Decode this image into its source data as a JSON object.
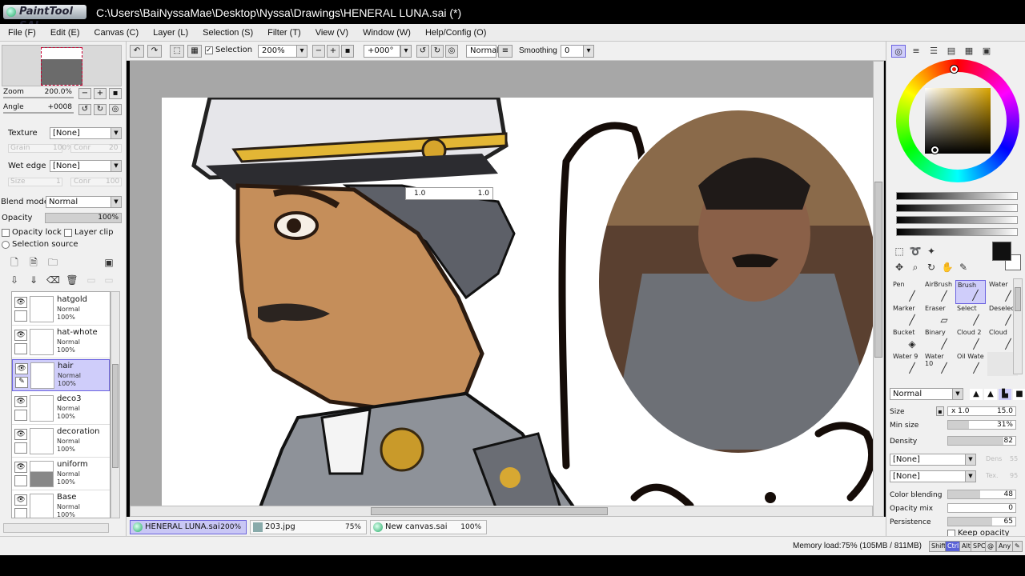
{
  "window": {
    "app_logo": "PaintTool SAI",
    "title": "C:\\Users\\BaiNyssaMae\\Desktop\\Nyssa\\Drawings\\HENERAL LUNA.sai (*)"
  },
  "menu": [
    "File (F)",
    "Edit (E)",
    "Canvas (C)",
    "Layer (L)",
    "Selection (S)",
    "Filter (T)",
    "View (V)",
    "Window (W)",
    "Help/Config (O)"
  ],
  "navigator": {
    "zoom_label": "Zoom",
    "zoom_value": "200.0%",
    "angle_label": "Angle",
    "angle_value": "+0008"
  },
  "texture": {
    "label": "Texture",
    "value": "[None]",
    "sub1": "Grain",
    "sub1_val": "100%",
    "sub2": "Conr",
    "sub2_val": "20"
  },
  "wet_edge": {
    "label": "Wet edge",
    "value": "[None]",
    "sub1": "Size",
    "sub1_val": "1",
    "sub2": "Conr",
    "sub2_val": "100"
  },
  "blend": {
    "label": "Blend mode",
    "value": "Normal"
  },
  "opacity": {
    "label": "Opacity",
    "value": "100%"
  },
  "checks": {
    "opacity_lock": "Opacity lock",
    "layer_clip": "Layer clip",
    "selection_source": "Selection source"
  },
  "layers": [
    {
      "name": "hatgold",
      "mode": "Normal",
      "opacity": "100%",
      "selected": false
    },
    {
      "name": "hat-whote",
      "mode": "Normal",
      "opacity": "100%",
      "selected": false
    },
    {
      "name": "hair",
      "mode": "Normal",
      "opacity": "100%",
      "selected": true
    },
    {
      "name": "deco3",
      "mode": "Normal",
      "opacity": "100%",
      "selected": false
    },
    {
      "name": "decoration",
      "mode": "Normal",
      "opacity": "100%",
      "selected": false
    },
    {
      "name": "uniform",
      "mode": "Normal",
      "opacity": "100%",
      "selected": false
    },
    {
      "name": "Base",
      "mode": "Normal",
      "opacity": "100%",
      "selected": false
    }
  ],
  "toolbar": {
    "selection_label": "Selection",
    "zoom": "200%",
    "angle": "+000°",
    "blend": "Normal",
    "smoothing_label": "Smoothing",
    "smoothing_value": "0"
  },
  "tooltip": {
    "left": "1.0",
    "right": "1.0"
  },
  "doc_tabs": [
    {
      "name": "HENERAL LUNA.sai",
      "pct": "200%",
      "active": true
    },
    {
      "name": "203.jpg",
      "pct": "75%",
      "active": false
    },
    {
      "name": "New canvas.sai",
      "pct": "100%",
      "active": false
    }
  ],
  "status": {
    "memory": "Memory load:75% (105MB / 811MB)",
    "keys": [
      "Shift",
      "Ctrl",
      "Alt",
      "SPC",
      "@",
      "Any"
    ]
  },
  "brushes": [
    {
      "name": "Pen"
    },
    {
      "name": "AirBrush"
    },
    {
      "name": "Brush",
      "selected": true
    },
    {
      "name": "Water"
    },
    {
      "name": "Marker"
    },
    {
      "name": "Eraser"
    },
    {
      "name": "Select"
    },
    {
      "name": "Deselect"
    },
    {
      "name": "Bucket"
    },
    {
      "name": "Binary"
    },
    {
      "name": "Cloud 2"
    },
    {
      "name": "Cloud"
    },
    {
      "name": "Water 9"
    },
    {
      "name": "Water 10"
    },
    {
      "name": "Oil Wate"
    },
    {
      "name": ""
    }
  ],
  "brush_props": {
    "blend": "Normal",
    "size_label": "Size",
    "size_mult": "x 1.0",
    "size_value": "15.0",
    "min_size_label": "Min size",
    "min_size_value": "31%",
    "density_label": "Density",
    "density_value": "82",
    "tex1": "[None]",
    "tex1_sub": "Dens",
    "tex1_sub_val": "55",
    "tex2": "[None]",
    "tex2_sub": "Tex.",
    "tex2_sub_val": "95",
    "color_blending_label": "Color blending",
    "color_blending_value": "48",
    "opacity_mix_label": "Opacity mix",
    "opacity_mix_value": "0",
    "persistence_label": "Persistence",
    "persistence_value": "65",
    "keep_opacity_label": "Keep opacity"
  },
  "colors": {
    "selected_bg": "#cfcdfa",
    "selected_border": "#6b63e0",
    "primary_color": "#111111",
    "wheel_hue": "#d9a400"
  }
}
